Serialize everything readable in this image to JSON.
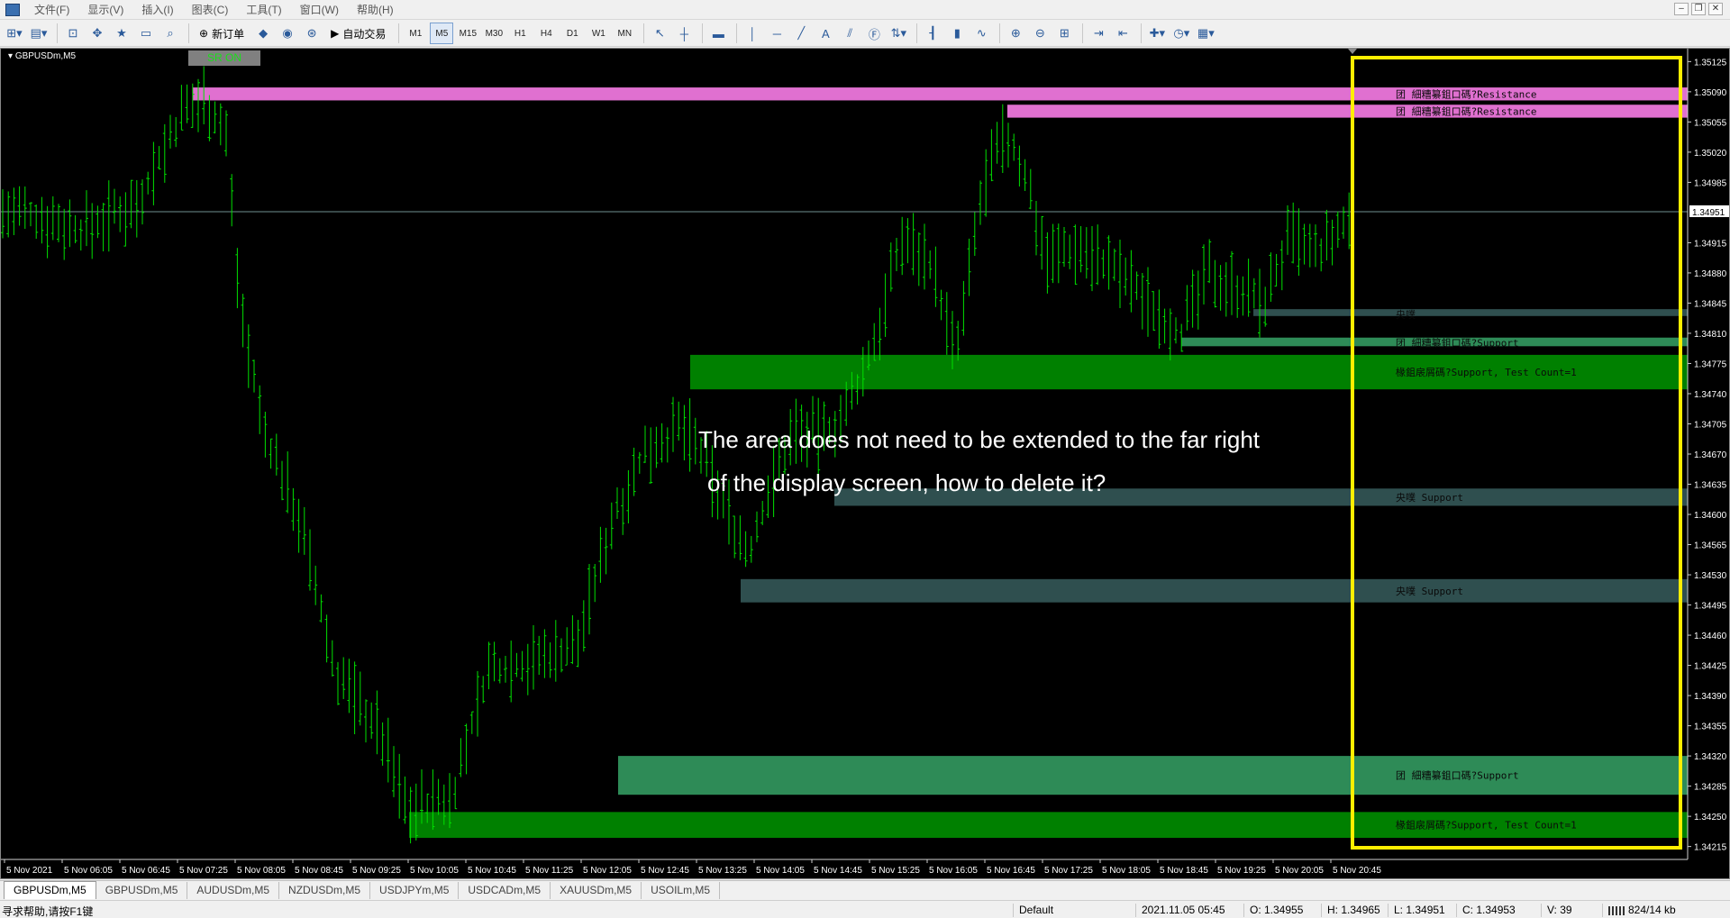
{
  "menu": [
    "文件(F)",
    "显示(V)",
    "插入(I)",
    "图表(C)",
    "工具(T)",
    "窗口(W)",
    "帮助(H)"
  ],
  "toolbar": {
    "new_order_label": "新订单",
    "autotrade_label": "自动交易",
    "timeframes": [
      "M1",
      "M5",
      "M15",
      "M30",
      "H1",
      "H4",
      "D1",
      "W1",
      "MN"
    ],
    "active_timeframe": "M5"
  },
  "chart": {
    "title": "GBPUSDm,M5",
    "sr_badge": "SR ON",
    "current_price": "1.34951",
    "colors": {
      "background": "#000000",
      "candle": "#00e000",
      "resistance_zone": "#e070d0",
      "support_strong": "#008000",
      "support_mid": "#2e8b57",
      "support_weak": "#2f4f4f",
      "highlight_box": "#ffee00"
    },
    "price_ticks": [
      "1.35125",
      "1.35090",
      "1.35055",
      "1.35020",
      "1.34985",
      "1.34915",
      "1.34880",
      "1.34845",
      "1.34810",
      "1.34775",
      "1.34740",
      "1.34705",
      "1.34670",
      "1.34635",
      "1.34600",
      "1.34565",
      "1.34530",
      "1.34495",
      "1.34460",
      "1.34425",
      "1.34390",
      "1.34355",
      "1.34320",
      "1.34285",
      "1.34250",
      "1.34215"
    ],
    "time_ticks": [
      "5 Nov 2021",
      "5 Nov 06:05",
      "5 Nov 06:45",
      "5 Nov 07:25",
      "5 Nov 08:05",
      "5 Nov 08:45",
      "5 Nov 09:25",
      "5 Nov 10:05",
      "5 Nov 10:45",
      "5 Nov 11:25",
      "5 Nov 12:05",
      "5 Nov 12:45",
      "5 Nov 13:25",
      "5 Nov 14:05",
      "5 Nov 14:45",
      "5 Nov 15:25",
      "5 Nov 16:05",
      "5 Nov 16:45",
      "5 Nov 17:25",
      "5 Nov 18:05",
      "5 Nov 18:45",
      "5 Nov 19:25",
      "5 Nov 20:05",
      "5 Nov 20:45"
    ],
    "zones": [
      {
        "type": "resistance",
        "label": "团 細糟纂鉏口碼?Resistance",
        "price_top": 1.35095,
        "price_bottom": 1.3508,
        "strength": "strong"
      },
      {
        "type": "resistance",
        "label": "团 細糟纂鉏口碼?Resistance",
        "price_top": 1.35075,
        "price_bottom": 1.3506,
        "strength": "strong"
      },
      {
        "type": "support",
        "label": "央噗",
        "price_top": 1.34838,
        "price_bottom": 1.3483,
        "strength": "weak"
      },
      {
        "type": "support",
        "label": "团 細糟纂鉏口碼?Support",
        "price_top": 1.34805,
        "price_bottom": 1.34795,
        "strength": "mid"
      },
      {
        "type": "support",
        "label": "椽鉏扆屑碼?Support, Test Count=1",
        "price_top": 1.34785,
        "price_bottom": 1.34745,
        "strength": "strong"
      },
      {
        "type": "support",
        "label": "央噗  Support",
        "price_top": 1.3463,
        "price_bottom": 1.3461,
        "strength": "weak"
      },
      {
        "type": "support",
        "label": "央噗  Support",
        "price_top": 1.34525,
        "price_bottom": 1.34498,
        "strength": "weak"
      },
      {
        "type": "support",
        "label": "团 細糟纂鉏口碼?Support",
        "price_top": 1.3432,
        "price_bottom": 1.34275,
        "strength": "mid"
      },
      {
        "type": "support",
        "label": "椽鉏扆屑碼?Support, Test Count=1",
        "price_top": 1.34255,
        "price_bottom": 1.34225,
        "strength": "strong"
      }
    ]
  },
  "annotation": {
    "line1": "The area does not need to be extended to the far right",
    "line2": "of the display screen, how to delete it?"
  },
  "tabs": [
    "GBPUSDm,M5",
    "GBPUSDm,M5",
    "AUDUSDm,M5",
    "NZDUSDm,M5",
    "USDJPYm,M5",
    "USDCADm,M5",
    "XAUUSDm,M5",
    "USOILm,M5"
  ],
  "status": {
    "help": "寻求帮助,请按F1键",
    "profile": "Default",
    "datetime": "2021.11.05 05:45",
    "open": "O: 1.34955",
    "high": "H: 1.34965",
    "low": "L: 1.34951",
    "close": "C: 1.34953",
    "volume": "V: 39",
    "traffic": "824/14 kb"
  }
}
